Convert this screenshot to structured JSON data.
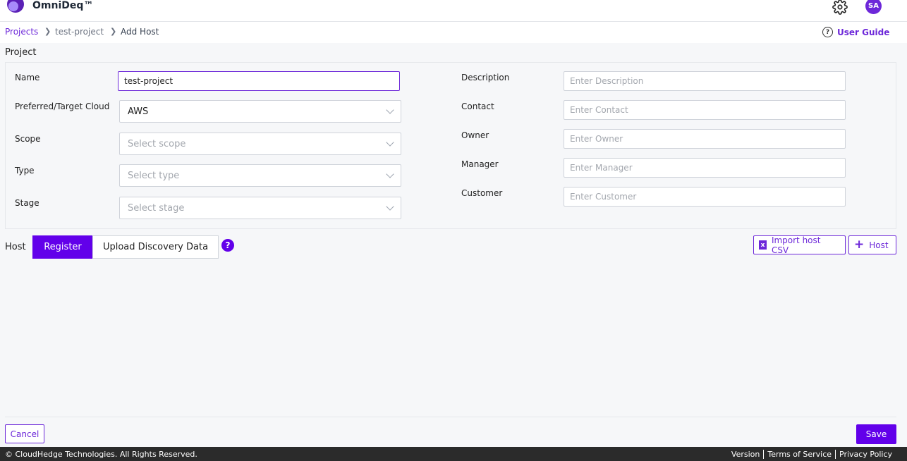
{
  "header": {
    "app_title": "OmniDeq™",
    "avatar_initials": "SA"
  },
  "breadcrumb": {
    "projects": "Projects",
    "project": "test-project",
    "current": "Add Host",
    "user_guide": "User Guide"
  },
  "project": {
    "section_title": "Project",
    "fields_left": {
      "name": {
        "label": "Name",
        "value": "test-project"
      },
      "cloud": {
        "label": "Preferred/Target Cloud",
        "value": "AWS"
      },
      "scope": {
        "label": "Scope",
        "placeholder": "Select scope"
      },
      "type": {
        "label": "Type",
        "placeholder": "Select type"
      },
      "stage": {
        "label": "Stage",
        "placeholder": "Select stage"
      }
    },
    "fields_right": {
      "description": {
        "label": "Description",
        "placeholder": "Enter Description"
      },
      "contact": {
        "label": "Contact",
        "placeholder": "Enter Contact"
      },
      "owner": {
        "label": "Owner",
        "placeholder": "Enter Owner"
      },
      "manager": {
        "label": "Manager",
        "placeholder": "Enter Manager"
      },
      "customer": {
        "label": "Customer",
        "placeholder": "Enter Customer"
      }
    }
  },
  "host": {
    "section_title": "Host",
    "tabs": [
      "Register",
      "Upload Discovery Data"
    ],
    "import_csv": "Import host CSV",
    "add_host": "Host"
  },
  "actions": {
    "cancel": "Cancel",
    "save": "Save"
  },
  "footer": {
    "copyright": "© CloudHedge Technologies. All Rights Reserved.",
    "links": [
      "Version",
      "Terms of Service",
      "Privacy Policy"
    ]
  },
  "colors": {
    "accent": "#6200ea",
    "brand_purple": "#6d28d9",
    "footer_bg": "#2b2b2b"
  }
}
